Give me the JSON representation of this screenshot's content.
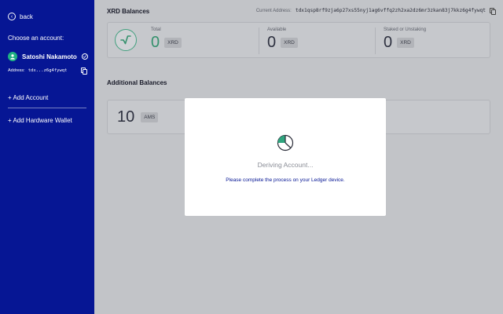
{
  "sidebar": {
    "back_label": "back",
    "choose_label": "Choose an account:",
    "account_name": "Satoshi Nakamoto",
    "address_label": "Address:",
    "address_short": "tdx...z6g4fywqt",
    "add_account_label": "+ Add Account",
    "add_hardware_label": "+ Add Hardware Wallet"
  },
  "main": {
    "xrd_title": "XRD Balances",
    "current_address_label": "Current Address:",
    "current_address": "tdx1qsp8rf9zja6p27xs55nyj1ag6vffq2zh2xa2dz6mr3zkan83j7kkz6g4fywqt",
    "balances": [
      {
        "label": "Total",
        "value": "0",
        "token": "XRD"
      },
      {
        "label": "Available",
        "value": "0",
        "token": "XRD"
      },
      {
        "label": "Staked or Unstaking",
        "value": "0",
        "token": "XRD"
      }
    ],
    "additional_title": "Additional Balances",
    "additional": [
      {
        "value": "10",
        "token": "AMS"
      }
    ]
  },
  "modal": {
    "status": "Deriving Account...",
    "instruction": "Please complete the process on your Ledger device."
  },
  "colors": {
    "sidebar_bg": "#061694",
    "accent_green": "#35916d",
    "avatar_green": "#1fb183",
    "instruction_blue": "#061694"
  },
  "icons": [
    "back-arrow-icon",
    "user-icon",
    "check-circle-icon",
    "copy-icon",
    "radix-logo-icon",
    "loading-pie-icon"
  ]
}
